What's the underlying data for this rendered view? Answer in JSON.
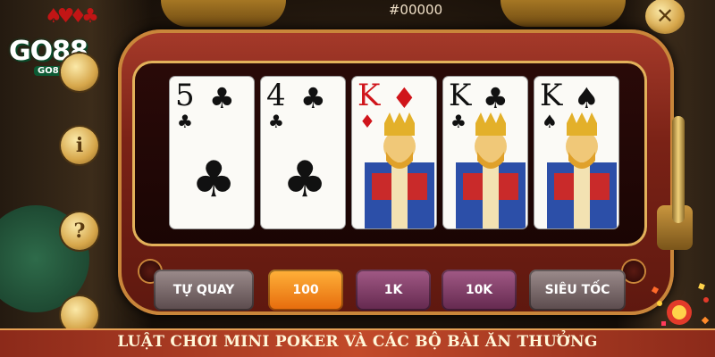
{
  "brand": {
    "logo_text": "GO88",
    "logo_sub": "GO88VG",
    "logo_cards": "♠♥♦♣"
  },
  "header": {
    "jackpot_value": "#00000"
  },
  "side_buttons": {
    "info_label": "i",
    "help_label": "?",
    "close_label": "✕"
  },
  "cards": [
    {
      "rank": "5",
      "suit": "♣",
      "suit_name": "club",
      "color": "#111111",
      "face": false
    },
    {
      "rank": "4",
      "suit": "♣",
      "suit_name": "club",
      "color": "#111111",
      "face": false
    },
    {
      "rank": "K",
      "suit": "♦",
      "suit_name": "diamond",
      "color": "#d0151b",
      "face": true
    },
    {
      "rank": "K",
      "suit": "♣",
      "suit_name": "club",
      "color": "#111111",
      "face": true
    },
    {
      "rank": "K",
      "suit": "♠",
      "suit_name": "spade",
      "color": "#111111",
      "face": true
    }
  ],
  "controls": {
    "auto_spin_label": "TỰ QUAY",
    "bet_100_label": "100",
    "bet_1k_label": "1K",
    "bet_10k_label": "10K",
    "turbo_label": "SIÊU TỐC",
    "selected_bet": "100"
  },
  "banner": {
    "title": "LUẬT CHƠI MINI POKER VÀ CÁC BỘ BÀI ĂN THƯỞNG"
  },
  "colors": {
    "accent_gold": "#e3b15a",
    "frame_red": "#7a2216",
    "selected_orange": "#ff9a2a",
    "banner_red": "#c24a2a"
  }
}
